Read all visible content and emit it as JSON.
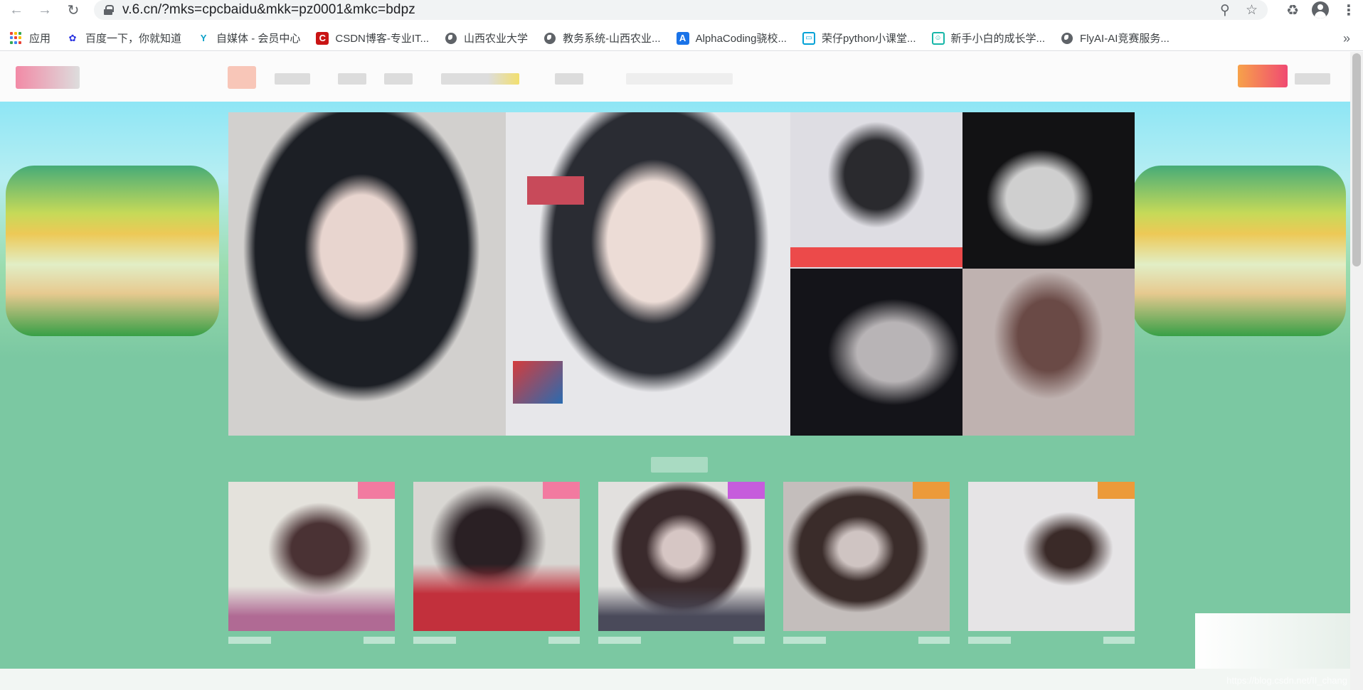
{
  "browser": {
    "url": "v.6.cn/?mks=cpcbaidu&mkk=pz0001&mkc=bdpz",
    "icons": {
      "back": "arrow-left-icon",
      "forward": "arrow-right-icon",
      "reload": "reload-icon",
      "zoom": "zoom-icon",
      "star": "star-icon",
      "extensions": "puzzle-icon",
      "profile": "profile-icon",
      "menu": "kebab-menu-icon"
    }
  },
  "bookmarks": [
    {
      "label": "应用",
      "icon": "apps-grid-icon"
    },
    {
      "label": "百度一下，你就知道",
      "icon": "baidu-paw-icon",
      "color": "#2932e1"
    },
    {
      "label": "自媒体 - 会员中心",
      "icon": "media-y-icon",
      "color": "#0aa0c8"
    },
    {
      "label": "CSDN博客-专业IT...",
      "icon": "csdn-c-icon",
      "color": "#c91414"
    },
    {
      "label": "山西农业大学",
      "icon": "globe-icon"
    },
    {
      "label": "教务系统-山西农业...",
      "icon": "globe-icon"
    },
    {
      "label": "AlphaCoding骁校...",
      "icon": "alphacoding-icon",
      "color": "#1a73e8"
    },
    {
      "label": "荣仔python小课堂...",
      "icon": "bilibili-tv-icon",
      "color": "#00a1d6"
    },
    {
      "label": "新手小白的成长学...",
      "icon": "chat-face-icon",
      "color": "#16b6a8"
    },
    {
      "label": "FlyAI-AI竞赛服务...",
      "icon": "globe-icon"
    }
  ],
  "more_bookmarks": "»",
  "watermark": "https://blog.csdn.net/II_chang"
}
